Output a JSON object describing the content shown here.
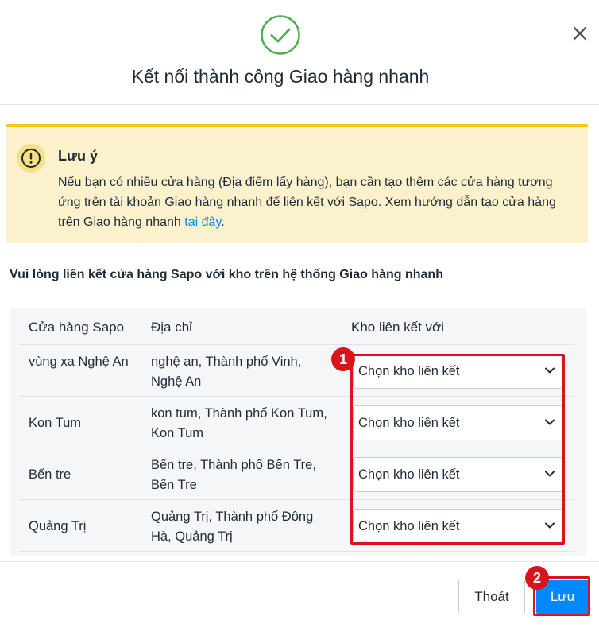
{
  "modal": {
    "title": "Kết nối thành công Giao hàng nhanh",
    "success_icon": "check-circle-icon",
    "close_icon": "close-icon"
  },
  "alert": {
    "icon": "warning-circle-icon",
    "title": "Lưu ý",
    "body": "Nếu bạn có nhiều cửa hàng (Địa điểm lấy hàng), bạn cần tạo thêm các cửa hàng tương ứng trên tài khoản Giao hàng nhanh để liên kết với Sapo. Xem hướng dẫn tạo cửa hàng trên Giao hàng nhanh",
    "link_text": "tại đây",
    "suffix": "."
  },
  "instruction": "Vui lòng liên kết cửa hàng Sapo với kho trên hệ thống Giao hàng nhanh",
  "table": {
    "headers": [
      "Cửa hàng Sapo",
      "Địa chỉ",
      "Kho liên kết với"
    ],
    "rows": [
      {
        "store": "vùng xa Nghệ An",
        "address": "nghệ an, Thành phố Vinh, Nghệ An",
        "select": "Chọn kho liên kết"
      },
      {
        "store": "Kon Tum",
        "address": "kon tum, Thành phố Kon Tum, Kon Tum",
        "select": "Chọn kho liên kết"
      },
      {
        "store": "Bến tre",
        "address": "Bến tre, Thành phố Bến Tre, Bến Tre",
        "select": "Chọn kho liên kết"
      },
      {
        "store": "Quảng Trị",
        "address": "Quảng Trị, Thành phố Đông Hà, Quảng Trị",
        "select": "Chọn kho liên kết"
      }
    ]
  },
  "annotations": {
    "step1": "1",
    "step2": "2"
  },
  "footer": {
    "exit_label": "Thoát",
    "save_label": "Lưu"
  },
  "colors": {
    "primary": "#0088ff",
    "success": "#4caf50",
    "warning": "#f5c518",
    "highlight": "#d9141c"
  }
}
